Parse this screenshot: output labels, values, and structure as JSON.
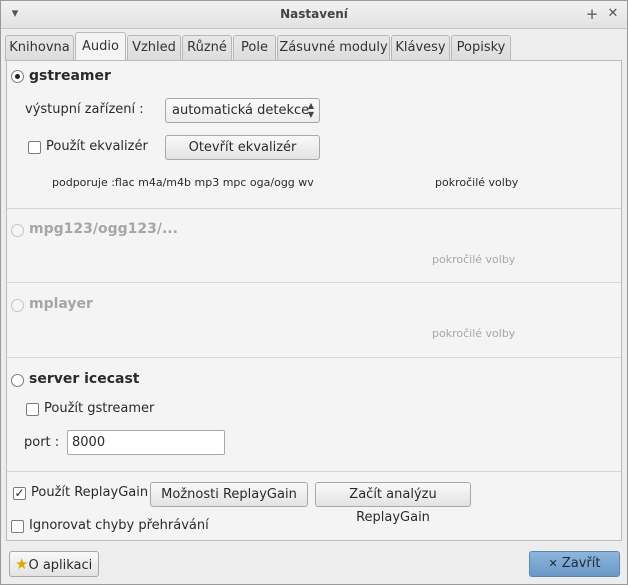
{
  "window": {
    "title": "Nastavení"
  },
  "tabs": [
    {
      "label": "Knihovna"
    },
    {
      "label": "Audio"
    },
    {
      "label": "Vzhled"
    },
    {
      "label": "Různé"
    },
    {
      "label": "Pole"
    },
    {
      "label": "Zásuvné moduly"
    },
    {
      "label": "Klávesy"
    },
    {
      "label": "Popisky"
    }
  ],
  "active_tab": "Audio",
  "gstreamer": {
    "label": "gstreamer",
    "selected": true,
    "output_device_label": "výstupní zařízení :",
    "output_device_value": "automatická detekce",
    "use_equalizer_label": "Použít ekvalizér",
    "use_equalizer_checked": false,
    "open_equalizer_label": "Otevřít ekvalizér",
    "supports_text": "podporuje :flac m4a/m4b mp3 mpc oga/ogg wv",
    "advanced_label": "pokročilé volby"
  },
  "mpg123": {
    "label": "mpg123/ogg123/...",
    "advanced_label": "pokročilé volby",
    "enabled": false
  },
  "mplayer": {
    "label": "mplayer",
    "advanced_label": "pokročilé volby",
    "enabled": false
  },
  "icecast": {
    "label": "server icecast",
    "selected": false,
    "use_gstreamer_label": "Použít gstreamer",
    "use_gstreamer_checked": false,
    "port_label": "port :",
    "port_value": "8000"
  },
  "replaygain": {
    "use_label": "Použít ReplayGain",
    "use_checked": true,
    "options_label": "Možnosti ReplayGain",
    "analyze_label": "Začít analýzu ReplayGain"
  },
  "ignore_errors": {
    "label": "Ignorovat chyby přehrávání",
    "checked": false
  },
  "footer": {
    "about_label": "O aplikaci",
    "close_label": "Zavřít"
  }
}
